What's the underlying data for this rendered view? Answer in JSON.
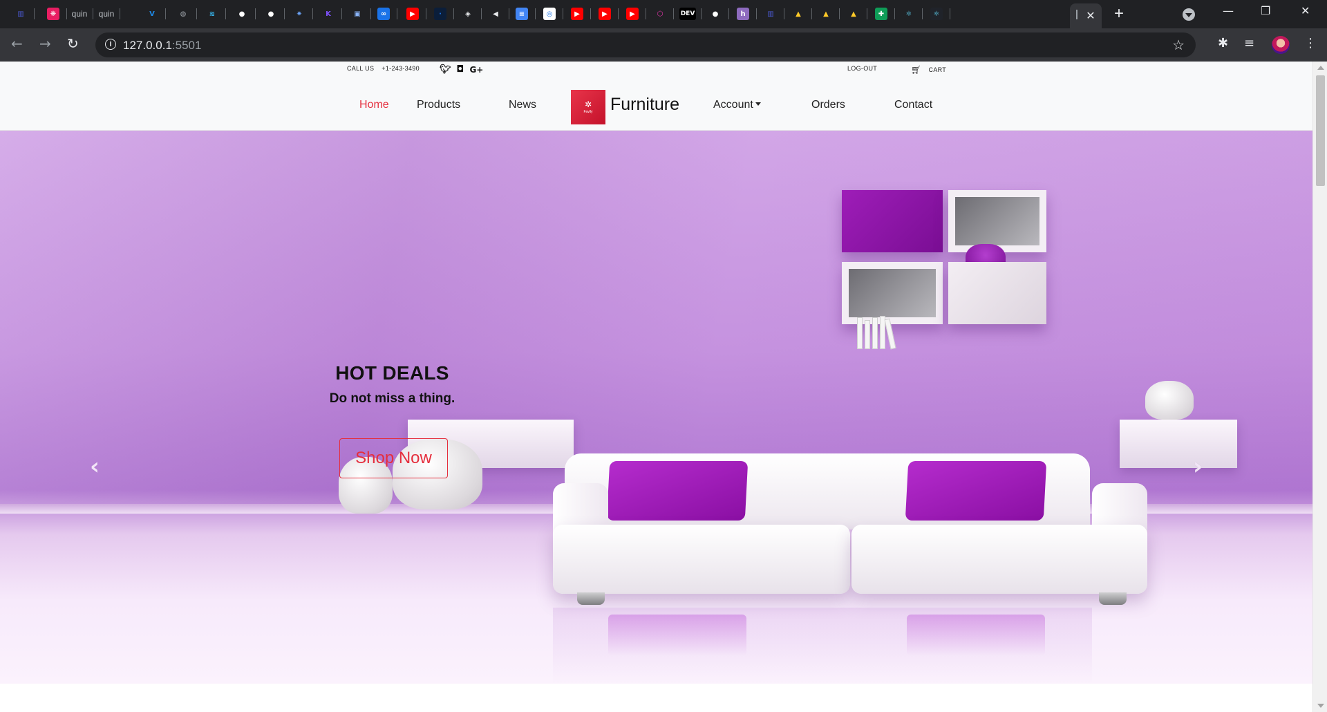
{
  "browser": {
    "tabs": [
      {
        "icon": "analytics-tab-icon",
        "glyph": "▥",
        "bg": "#202124",
        "fg": "#4b5bd6"
      },
      {
        "icon": "react-pink-tab-icon",
        "glyph": "❋",
        "bg": "#e91e63",
        "fg": "#ffffff"
      },
      {
        "icon": "text-tab",
        "text": "quin"
      },
      {
        "icon": "text-tab",
        "text": "quin"
      },
      {
        "icon": "vuetify-tab-icon",
        "glyph": "V",
        "bg": "#202124",
        "fg": "#1e88e5"
      },
      {
        "icon": "globe-tab-icon",
        "glyph": "◍",
        "bg": "#202124",
        "fg": "#9aa0a6"
      },
      {
        "icon": "tailwind-tab-icon",
        "glyph": "≋",
        "bg": "#202124",
        "fg": "#38bdf8"
      },
      {
        "icon": "github-tab-icon",
        "glyph": "●",
        "bg": "#202124",
        "fg": "#ffffff"
      },
      {
        "icon": "github-tab-icon",
        "glyph": "●",
        "bg": "#202124",
        "fg": "#ffffff"
      },
      {
        "icon": "star-tab-icon",
        "glyph": "✷",
        "bg": "#202124",
        "fg": "#6ea8fe"
      },
      {
        "icon": "kotlin-tab-icon",
        "glyph": "K",
        "bg": "#202124",
        "fg": "#7f52ff"
      },
      {
        "icon": "image-tab-icon",
        "glyph": "▣",
        "bg": "#202124",
        "fg": "#8ab4f8"
      },
      {
        "icon": "infinity-tab-icon",
        "glyph": "∞",
        "bg": "#1a73e8",
        "fg": "#ffffff"
      },
      {
        "icon": "youtube-tab-icon",
        "glyph": "▶",
        "bg": "#ff0000",
        "fg": "#ffffff"
      },
      {
        "icon": "dark-tab-icon",
        "glyph": "·",
        "bg": "#0b1e3a",
        "fg": "#1a73e8"
      },
      {
        "icon": "cube-tab-icon",
        "glyph": "◈",
        "bg": "#202124",
        "fg": "#e8eaed"
      },
      {
        "icon": "audio-tab-icon",
        "glyph": "◀",
        "bg": "#202124",
        "fg": "#e8eaed"
      },
      {
        "icon": "docs-tab-icon",
        "glyph": "≡",
        "bg": "#4285f4",
        "fg": "#ffffff"
      },
      {
        "icon": "camera-tab-icon",
        "glyph": "◎",
        "bg": "#ffffff",
        "fg": "#1a73e8"
      },
      {
        "icon": "youtube-tab-icon",
        "glyph": "▶",
        "bg": "#ff0000",
        "fg": "#ffffff"
      },
      {
        "icon": "youtube-tab-icon",
        "glyph": "▶",
        "bg": "#ff0000",
        "fg": "#ffffff"
      },
      {
        "icon": "youtube-tab-icon",
        "glyph": "▶",
        "bg": "#ff0000",
        "fg": "#ffffff"
      },
      {
        "icon": "graphql-tab-icon",
        "glyph": "⬡",
        "bg": "#202124",
        "fg": "#e535ab"
      },
      {
        "icon": "dev-tab-icon",
        "glyph": "DEV",
        "bg": "#000000",
        "fg": "#ffffff"
      },
      {
        "icon": "github-tab-icon",
        "glyph": "●",
        "bg": "#202124",
        "fg": "#ffffff"
      },
      {
        "icon": "hashnode-tab-icon",
        "glyph": "h",
        "bg": "#8e6bbf",
        "fg": "#ffffff"
      },
      {
        "icon": "analytics-tab-icon",
        "glyph": "▥",
        "bg": "#202124",
        "fg": "#4b5bd6"
      },
      {
        "icon": "firebase-tab-icon",
        "glyph": "▲",
        "bg": "#202124",
        "fg": "#ffca28"
      },
      {
        "icon": "firebase-tab-icon",
        "glyph": "▲",
        "bg": "#202124",
        "fg": "#ffca28"
      },
      {
        "icon": "firebase-tab-icon",
        "glyph": "▲",
        "bg": "#202124",
        "fg": "#ffca28"
      },
      {
        "icon": "sheets-plus-tab-icon",
        "glyph": "✚",
        "bg": "#0f9d58",
        "fg": "#ffffff"
      },
      {
        "icon": "react-tab-icon",
        "glyph": "⚛",
        "bg": "#202124",
        "fg": "#61dafb"
      },
      {
        "icon": "react-tab-icon",
        "glyph": "⚛",
        "bg": "#20232a",
        "fg": "#61dafb"
      }
    ],
    "active_tab_close": "✕",
    "new_tab": "+",
    "window": {
      "minimize": "—",
      "restore": "❐",
      "close": "✕"
    },
    "url_host": "127.0.0.1",
    "url_port": ":5501"
  },
  "site": {
    "call_label": "CALL US",
    "phone": "+1-243-3490",
    "logout": "LOG-OUT",
    "cart": "CART",
    "nav": {
      "home": "Home",
      "products": "Products",
      "news": "News",
      "account": "Account",
      "orders": "Orders",
      "contact": "Contact"
    },
    "brand": "Furniture",
    "logo_text": "Favlly",
    "hero": {
      "title": "HOT DEALS",
      "subtitle": "Do not miss a thing.",
      "cta": "Shop Now",
      "prev": "‹",
      "next": "›"
    }
  },
  "colors": {
    "accent": "#e52e3d",
    "hero_wall": "#c592df",
    "cushion": "#9e1db8"
  }
}
